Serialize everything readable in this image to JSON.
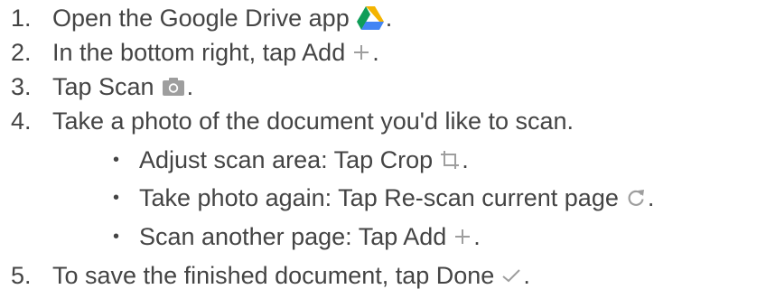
{
  "steps": [
    {
      "number": "1.",
      "text": "Open the Google Drive app",
      "icon": "google-drive-icon",
      "suffix": "."
    },
    {
      "number": "2.",
      "text": "In the bottom right, tap Add",
      "icon": "plus-icon",
      "suffix": "."
    },
    {
      "number": "3.",
      "text": "Tap Scan",
      "icon": "camera-icon",
      "suffix": "."
    },
    {
      "number": "4.",
      "text": "Take a photo of the document you'd like to scan.",
      "icon": "",
      "suffix": ""
    },
    {
      "number": "5.",
      "text": "To save the finished document, tap Done",
      "icon": "checkmark-icon",
      "suffix": "."
    }
  ],
  "substeps": [
    {
      "bullet": "•",
      "text": "Adjust scan area: Tap Crop",
      "icon": "crop-icon",
      "suffix": "."
    },
    {
      "bullet": "•",
      "text": "Take photo again: Tap Re-scan current page",
      "icon": "refresh-icon",
      "suffix": "."
    },
    {
      "bullet": "•",
      "text": "Scan another page: Tap Add",
      "icon": "plus-icon",
      "suffix": "."
    }
  ],
  "colors": {
    "text": "#444444",
    "icon_gray": "#9e9e9e",
    "drive_green": "#0f9d58",
    "drive_yellow": "#f4b400",
    "drive_blue": "#4285f4"
  }
}
